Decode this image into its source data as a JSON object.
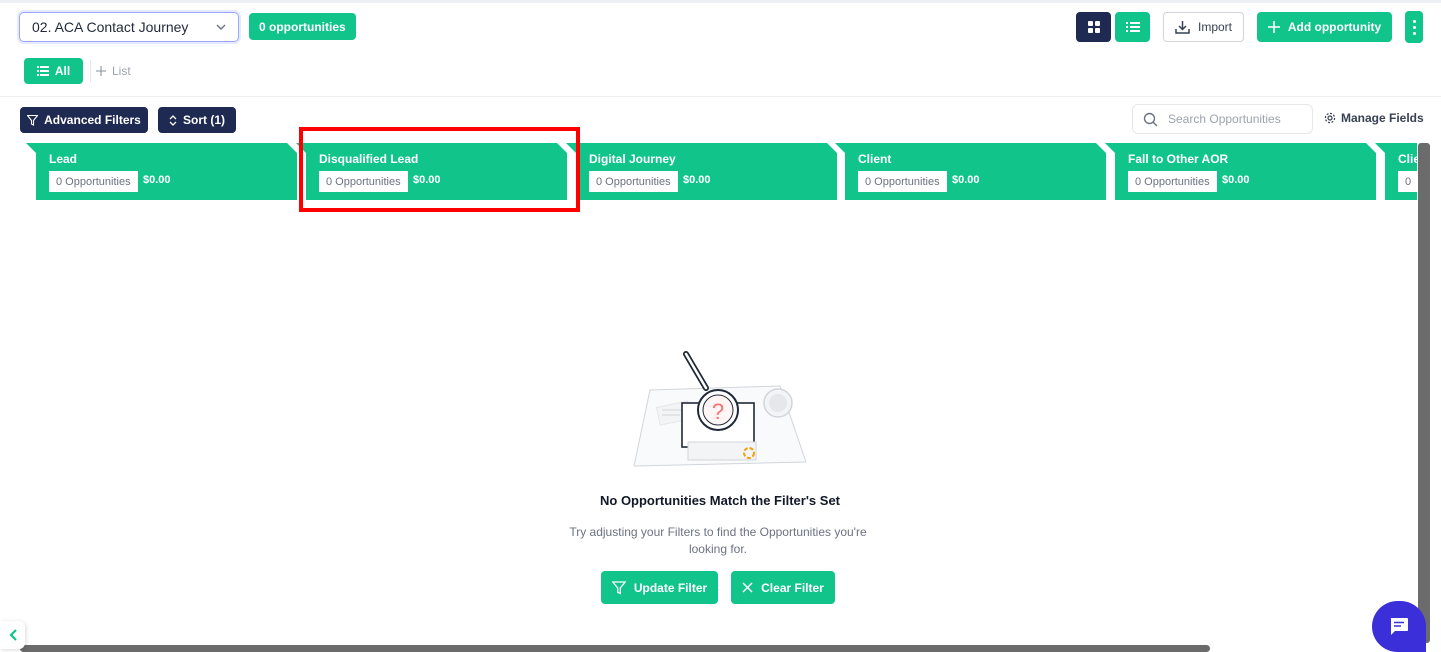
{
  "colors": {
    "accent": "#10c48a",
    "navy": "#1f2a52",
    "highlight": "#ff0000",
    "chat": "#3b2fd9"
  },
  "header": {
    "pipeline_selected": "02. ACA Contact Journey",
    "opportunity_count": "0 opportunities",
    "import_label": "Import",
    "add_label": "Add opportunity"
  },
  "tabs": {
    "all_label": "All",
    "list_label": "List"
  },
  "toolbar": {
    "advanced_filters_label": "Advanced Filters",
    "sort_label": "Sort (1)",
    "search_placeholder": "Search Opportunities",
    "manage_fields_label": "Manage Fields"
  },
  "stages": [
    {
      "name": "Lead",
      "count": "0 Opportunities",
      "amount": "$0.00"
    },
    {
      "name": "Disqualified Lead",
      "count": "0 Opportunities",
      "amount": "$0.00"
    },
    {
      "name": "Digital Journey",
      "count": "0 Opportunities",
      "amount": "$0.00"
    },
    {
      "name": "Client",
      "count": "0 Opportunities",
      "amount": "$0.00"
    },
    {
      "name": "Fall to Other AOR",
      "count": "0 Opportunities",
      "amount": "$0.00"
    },
    {
      "name": "Clie",
      "count": "0",
      "amount": ""
    }
  ],
  "empty_state": {
    "title": "No Opportunities Match the Filter's Set",
    "description": "Try adjusting your Filters to find the Opportunities you're looking for.",
    "update_filter_label": "Update Filter",
    "clear_filter_label": "Clear Filter",
    "illustration_glyph": "?"
  },
  "icons": {
    "select_chevron": "chevron-down-icon",
    "view_grid": "grid-icon",
    "view_list": "list-icon",
    "import": "download-icon",
    "add": "plus-icon",
    "more": "more-vertical-icon",
    "filter": "filter-icon",
    "sort": "sort-icon",
    "search": "search-icon",
    "settings": "gear-icon",
    "close": "close-icon",
    "collapse": "chevron-left-icon",
    "chat": "chat-icon"
  }
}
